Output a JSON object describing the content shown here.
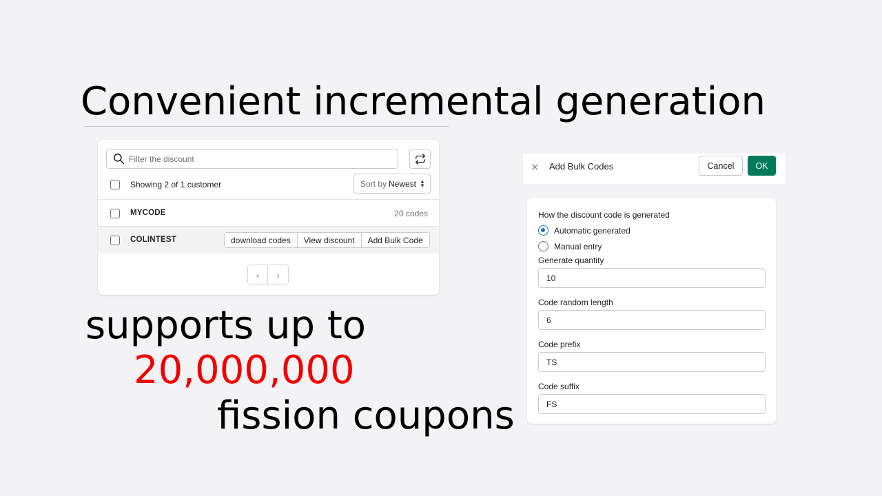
{
  "headline": "Convenient incremental generation",
  "promo": {
    "line1": "supports up to",
    "line2": "20,000,000",
    "line3": "fission coupons",
    "highlight_color": "#f20000"
  },
  "discount_list": {
    "search": {
      "placeholder": "Filter the discount",
      "value": "",
      "icon": "search-icon"
    },
    "refresh_icon": "refresh-icon",
    "header": {
      "count_label": "Showing 2 of 1 customer",
      "sort_prefix": "Sort by",
      "sort_value": "Newest"
    },
    "rows": [
      {
        "code": "MYCODE",
        "count": "20 codes"
      },
      {
        "code": "COLINTEST",
        "actions": [
          "download codes",
          "View discount",
          "Add Bulk Code"
        ]
      }
    ],
    "pagination": {
      "prev": "‹",
      "next": "›"
    }
  },
  "modal": {
    "title": "Add Bulk Codes",
    "cancel_label": "Cancel",
    "ok_label": "OK",
    "ok_color": "#007a5a",
    "generation": {
      "legend": "How the discount code is generated",
      "options": [
        {
          "label": "Automatic generated",
          "selected": true
        },
        {
          "label": "Manual entry",
          "selected": false
        }
      ]
    },
    "fields": [
      {
        "label": "Generate quantity",
        "value": "10"
      },
      {
        "label": "Code random length",
        "value": "6"
      },
      {
        "label": "Code prefix",
        "value": "TS"
      },
      {
        "label": "Code suffix",
        "value": "FS"
      }
    ]
  }
}
